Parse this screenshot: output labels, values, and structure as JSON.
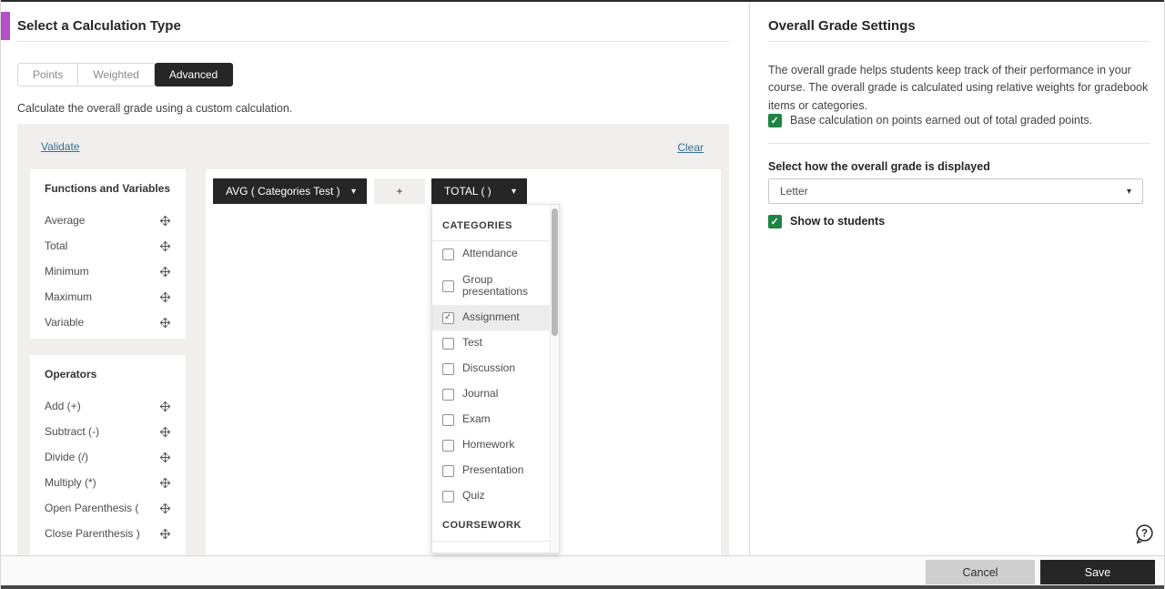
{
  "left_panel": {
    "title": "Select a Calculation Type",
    "tabs": [
      {
        "label": "Points",
        "active": false
      },
      {
        "label": "Weighted",
        "active": false
      },
      {
        "label": "Advanced",
        "active": true
      }
    ],
    "description": "Calculate the overall grade using a custom calculation.",
    "calc": {
      "validate_label": "Validate",
      "clear_label": "Clear",
      "functions": {
        "title": "Functions and Variables",
        "items": [
          "Average",
          "Total",
          "Minimum",
          "Maximum",
          "Variable"
        ]
      },
      "operators": {
        "title": "Operators",
        "items": [
          "Add (+)",
          "Subtract (-)",
          "Divide (/)",
          "Multiply (*)",
          "Open Parenthesis (",
          "Close Parenthesis )"
        ]
      },
      "expression": {
        "avg_chip": "AVG ( Categories Test )",
        "plus_chip": "+",
        "total_chip": "TOTAL ( )"
      },
      "dropdown": {
        "sections": [
          {
            "header": "CATEGORIES",
            "items": [
              {
                "label": "Attendance",
                "checked": false
              },
              {
                "label": "Group presentations",
                "checked": false
              },
              {
                "label": "Assignment",
                "checked": true
              },
              {
                "label": "Test",
                "checked": false
              },
              {
                "label": "Discussion",
                "checked": false
              },
              {
                "label": "Journal",
                "checked": false
              },
              {
                "label": "Exam",
                "checked": false
              },
              {
                "label": "Homework",
                "checked": false
              },
              {
                "label": "Presentation",
                "checked": false
              },
              {
                "label": "Quiz",
                "checked": false
              }
            ]
          },
          {
            "header": "COURSEWORK",
            "items": [
              {
                "label": "",
                "checked": false
              }
            ]
          }
        ]
      }
    }
  },
  "right_panel": {
    "title": "Overall Grade Settings",
    "description": "The overall grade helps students keep track of their performance in your course. The overall grade is calculated using relative weights for gradebook items or categories.",
    "base_points_checkbox": {
      "label": "Base calculation on points earned out of total graded points.",
      "checked": true
    },
    "display_label": "Select how the overall grade is displayed",
    "display_select": {
      "value": "Letter"
    },
    "show_to_students_checkbox": {
      "label": "Show to students",
      "checked": true
    }
  },
  "footer": {
    "cancel_label": "Cancel",
    "save_label": "Save"
  },
  "icons": {
    "drag_handle": "move-arrows-icon",
    "chip_caret": "chevron-down-icon",
    "help": "question-mark-bubble-icon"
  },
  "colors": {
    "accent_purple": "#b450c8",
    "checkbox_green": "#1e8343",
    "chip_dark": "#262626",
    "link_blue": "#356f90",
    "calc_area_bg": "#f0efee"
  }
}
